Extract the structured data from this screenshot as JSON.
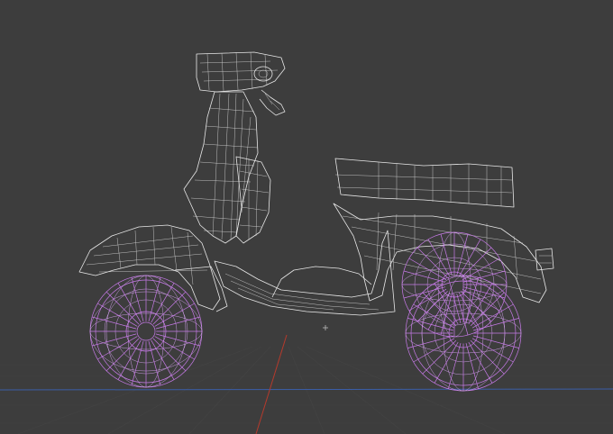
{
  "viewport": {
    "background": "#3d3d3d",
    "grid_color": "#444444",
    "x_axis_color": "#3b5ea8",
    "y_axis_color": "#b53a2c",
    "wire_color": "#e8e8e8",
    "selected_color": "#c77ae8"
  },
  "model": {
    "shading": "wireframe",
    "selected_parts": [
      "front-wheel",
      "rear-wheel"
    ]
  },
  "icons": {
    "origin": "origin-marker-icon"
  }
}
